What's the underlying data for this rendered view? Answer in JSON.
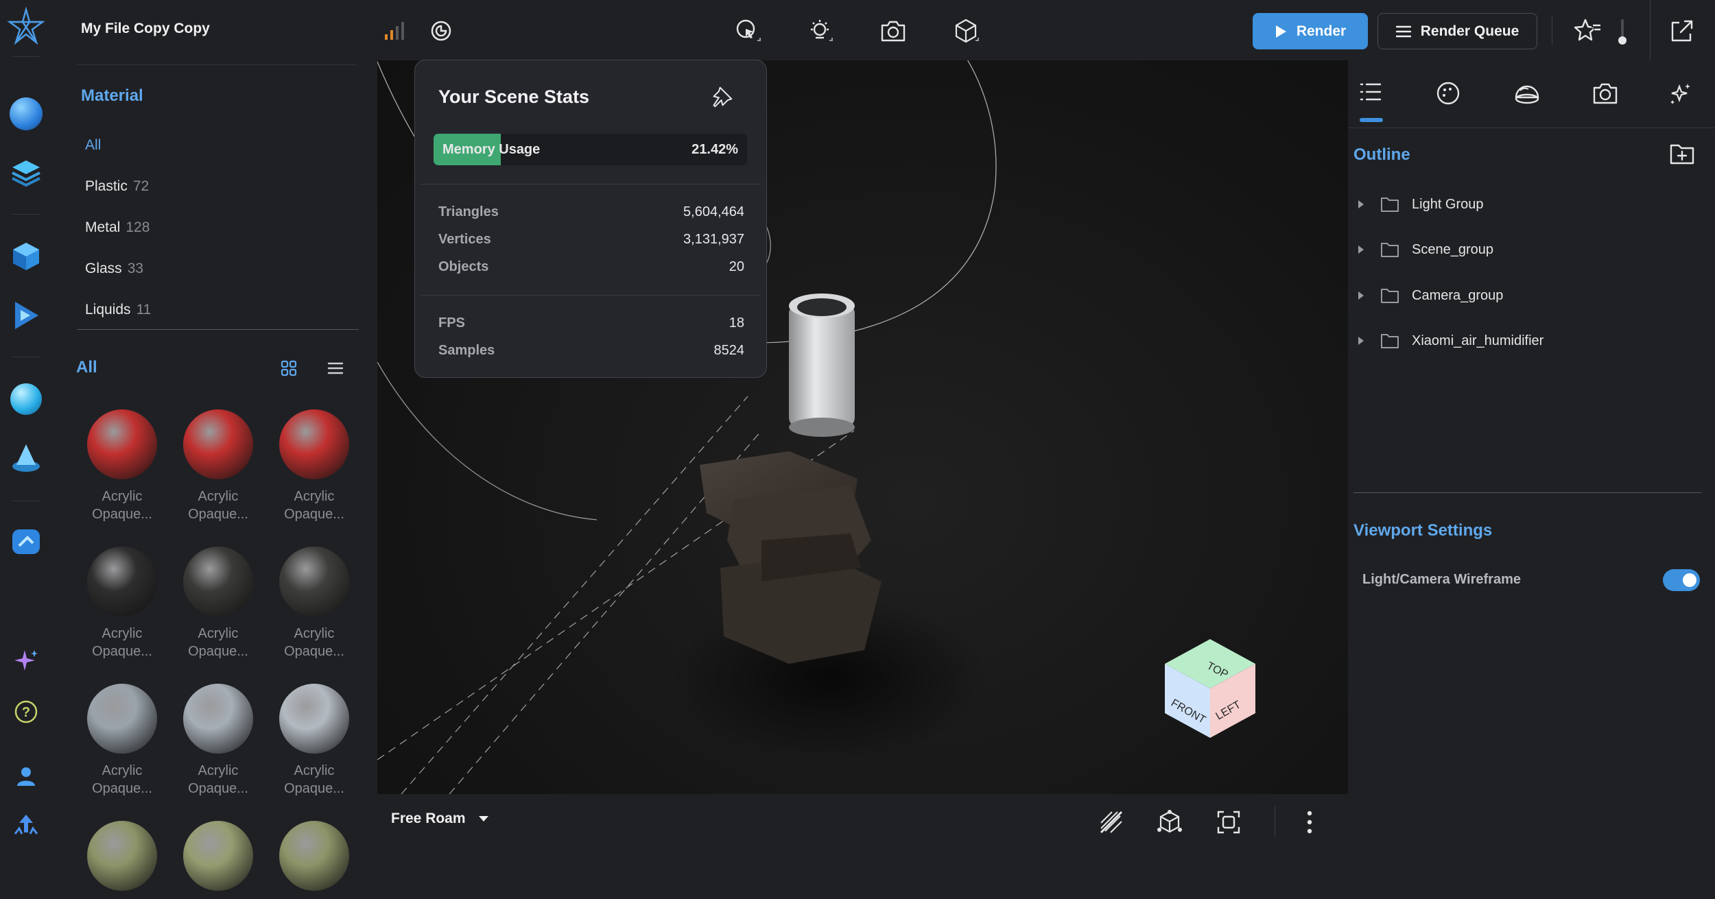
{
  "app": {
    "file_title": "My File Copy Copy"
  },
  "toolbar": {
    "render_label": "Render",
    "render_queue_label": "Render Queue",
    "icons": [
      "signal-icon",
      "timer-icon",
      "select-tool-icon",
      "light-tool-icon",
      "camera-tool-icon",
      "object-tool-icon",
      "star-settings-icon",
      "export-icon"
    ]
  },
  "materials": {
    "heading": "Material",
    "categories": [
      {
        "label": "All",
        "count": ""
      },
      {
        "label": "Plastic",
        "count": "72"
      },
      {
        "label": "Metal",
        "count": "128"
      },
      {
        "label": "Glass",
        "count": "33"
      },
      {
        "label": "Liquids",
        "count": "11"
      }
    ],
    "grid_heading": "All",
    "items": [
      {
        "label": "Acrylic Opaque...",
        "color": "#c0302f"
      },
      {
        "label": "Acrylic Opaque...",
        "color": "#c0302f"
      },
      {
        "label": "Acrylic Opaque...",
        "color": "#c0302f"
      },
      {
        "label": "Acrylic Opaque...",
        "color": "#2e2e2e"
      },
      {
        "label": "Acrylic Opaque...",
        "color": "#3a3a38"
      },
      {
        "label": "Acrylic Opaque...",
        "color": "#3e3e3c"
      },
      {
        "label": "Acrylic Opaque...",
        "color": "#9aa3ab"
      },
      {
        "label": "Acrylic Opaque...",
        "color": "#a6aeb6"
      },
      {
        "label": "Acrylic Opaque...",
        "color": "#b3bac1"
      },
      {
        "label": "",
        "color": "#8d9468"
      },
      {
        "label": "",
        "color": "#959c70"
      },
      {
        "label": "",
        "color": "#8d9468"
      }
    ]
  },
  "stats": {
    "title": "Your Scene Stats",
    "memory_label": "Memory Usage",
    "memory_value": "21.42%",
    "memory_fraction": 0.2142,
    "rows": [
      {
        "label": "Triangles",
        "value": "5,604,464"
      },
      {
        "label": "Vertices",
        "value": "3,131,937"
      },
      {
        "label": "Objects",
        "value": "20"
      }
    ],
    "rows2": [
      {
        "label": "FPS",
        "value": "18"
      },
      {
        "label": "Samples",
        "value": "8524"
      }
    ]
  },
  "viewport": {
    "mode_label": "Free Roam",
    "cube_faces": {
      "top": "TOP",
      "front": "FRONT",
      "left": "LEFT"
    }
  },
  "right_panel": {
    "tabs": [
      "outline-tab-icon",
      "material-tab-icon",
      "environment-tab-icon",
      "camera-tab-icon",
      "effects-tab-icon"
    ],
    "outline_heading": "Outline",
    "outline_items": [
      "Light Group",
      "Scene_group",
      "Camera_group",
      "Xiaomi_air_humidifier"
    ],
    "viewport_settings_heading": "Viewport Settings",
    "wireframe_label": "Light/Camera Wireframe",
    "wireframe_enabled": true
  },
  "colors": {
    "accent": "#3d91dd",
    "heading": "#5fa8ec",
    "memory_fill": "#3fa872"
  }
}
